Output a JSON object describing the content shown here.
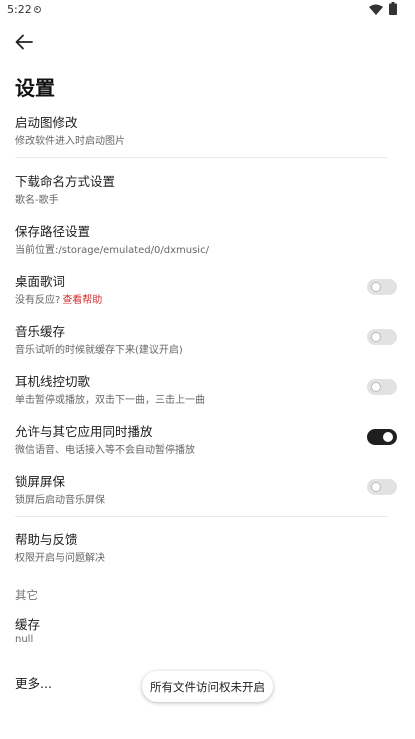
{
  "status_bar": {
    "time": "5:22"
  },
  "header": {
    "title": "设置"
  },
  "settings": {
    "splash": {
      "title": "启动图修改",
      "subtitle": "修改软件进入时启动图片"
    },
    "download_naming": {
      "title": "下载命名方式设置",
      "subtitle": "歌名-歌手"
    },
    "save_path": {
      "title": "保存路径设置",
      "subtitle": "当前位置:/storage/emulated/0/dxmusic/"
    },
    "desktop_lyrics": {
      "title": "桌面歌词",
      "subtitle": "没有反应?",
      "help_link": "查看帮助",
      "enabled": false
    },
    "music_cache": {
      "title": "音乐缓存",
      "subtitle": "音乐试听的时候就缓存下来(建议开启)",
      "enabled": false
    },
    "headset_control": {
      "title": "耳机线控切歌",
      "subtitle": "单击暂停或播放，双击下一曲，三击上一曲",
      "enabled": false
    },
    "concurrent_play": {
      "title": "允许与其它应用同时播放",
      "subtitle": "微信语音、电话接入等不会自动暂停播放",
      "enabled": true
    },
    "lockscreen": {
      "title": "锁屏屏保",
      "subtitle": "锁屏后启动音乐屏保",
      "enabled": false
    },
    "help_feedback": {
      "title": "帮助与反馈",
      "subtitle": "权限开启与问题解决"
    }
  },
  "other_section": {
    "header": "其它",
    "cache": {
      "title": "缓存",
      "subtitle": "null"
    },
    "more": {
      "title": "更多..."
    }
  },
  "toast": {
    "text": "所有文件访问权未开启"
  }
}
